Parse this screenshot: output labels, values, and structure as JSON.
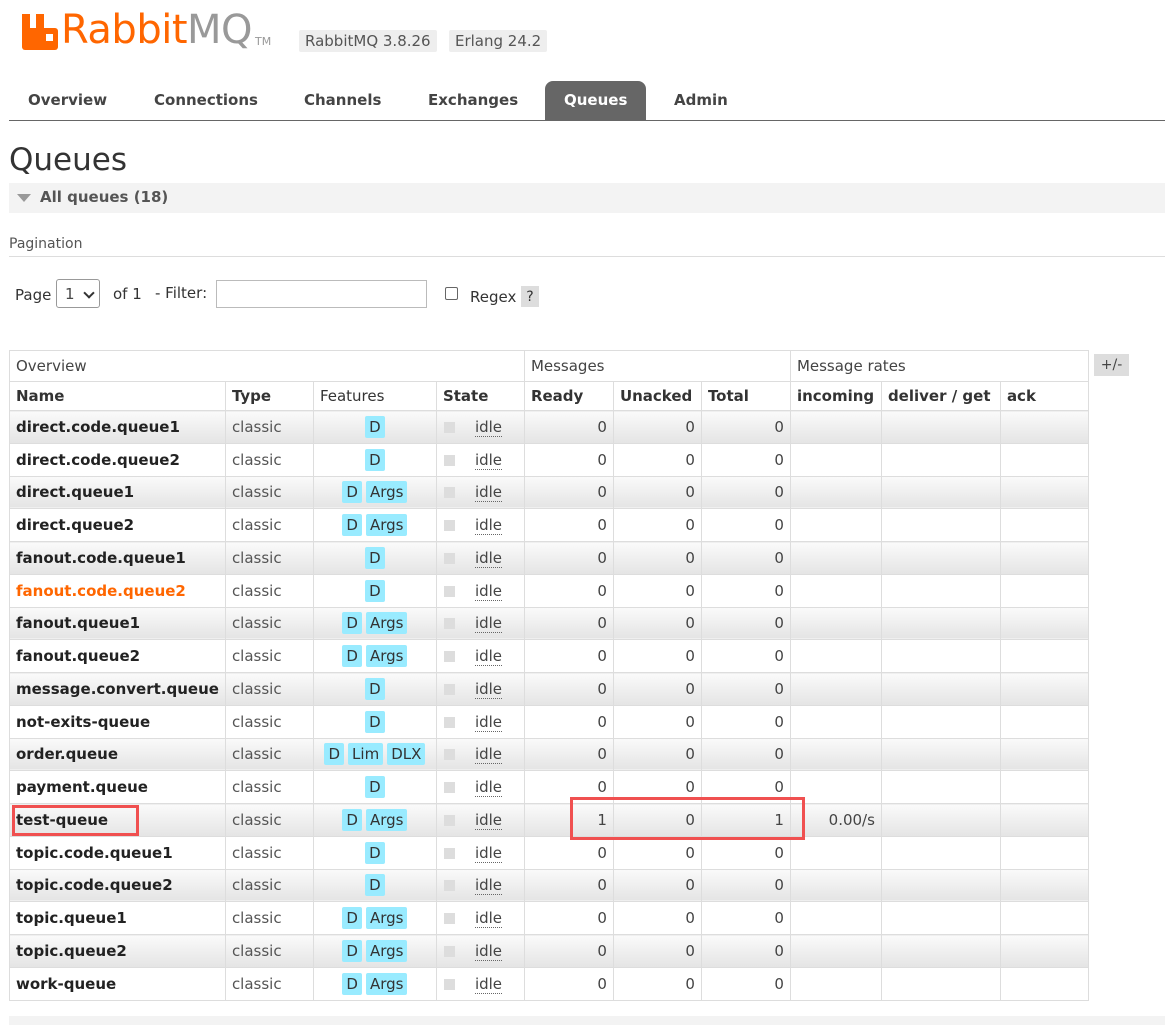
{
  "header": {
    "logo_rabbit": "Rabbit",
    "logo_mq": "MQ",
    "logo_tm": "TM",
    "rabbitmq_version": "RabbitMQ 3.8.26",
    "erlang_version": "Erlang 24.2",
    "brand_color": "#ff6600"
  },
  "tabs": [
    {
      "label": "Overview"
    },
    {
      "label": "Connections"
    },
    {
      "label": "Channels"
    },
    {
      "label": "Exchanges"
    },
    {
      "label": "Queues",
      "active": true
    },
    {
      "label": "Admin"
    }
  ],
  "page_title": "Queues",
  "section": {
    "title": "All queues (18)"
  },
  "pagination": {
    "label": "Pagination",
    "page_label": "Page",
    "page_value": "1",
    "of_label": "of 1",
    "filter_label": "- Filter:",
    "filter_value": "",
    "regex_label": "Regex",
    "regex_checked": false,
    "help_label": "?"
  },
  "columns_toggle": "+/-",
  "table": {
    "groups": [
      "Overview",
      "Messages",
      "Message rates"
    ],
    "columns": [
      "Name",
      "Type",
      "Features",
      "State",
      "Ready",
      "Unacked",
      "Total",
      "incoming",
      "deliver / get",
      "ack"
    ],
    "rows": [
      {
        "name": "direct.code.queue1",
        "type": "classic",
        "features": [
          "D"
        ],
        "state": "idle",
        "ready": "0",
        "unacked": "0",
        "total": "0",
        "incoming": "",
        "deliver": "",
        "ack": ""
      },
      {
        "name": "direct.code.queue2",
        "type": "classic",
        "features": [
          "D"
        ],
        "state": "idle",
        "ready": "0",
        "unacked": "0",
        "total": "0",
        "incoming": "",
        "deliver": "",
        "ack": ""
      },
      {
        "name": "direct.queue1",
        "type": "classic",
        "features": [
          "D",
          "Args"
        ],
        "state": "idle",
        "ready": "0",
        "unacked": "0",
        "total": "0",
        "incoming": "",
        "deliver": "",
        "ack": ""
      },
      {
        "name": "direct.queue2",
        "type": "classic",
        "features": [
          "D",
          "Args"
        ],
        "state": "idle",
        "ready": "0",
        "unacked": "0",
        "total": "0",
        "incoming": "",
        "deliver": "",
        "ack": ""
      },
      {
        "name": "fanout.code.queue1",
        "type": "classic",
        "features": [
          "D"
        ],
        "state": "idle",
        "ready": "0",
        "unacked": "0",
        "total": "0",
        "incoming": "",
        "deliver": "",
        "ack": ""
      },
      {
        "name": "fanout.code.queue2",
        "type": "classic",
        "features": [
          "D"
        ],
        "state": "idle",
        "ready": "0",
        "unacked": "0",
        "total": "0",
        "incoming": "",
        "deliver": "",
        "ack": "",
        "hover": true
      },
      {
        "name": "fanout.queue1",
        "type": "classic",
        "features": [
          "D",
          "Args"
        ],
        "state": "idle",
        "ready": "0",
        "unacked": "0",
        "total": "0",
        "incoming": "",
        "deliver": "",
        "ack": ""
      },
      {
        "name": "fanout.queue2",
        "type": "classic",
        "features": [
          "D",
          "Args"
        ],
        "state": "idle",
        "ready": "0",
        "unacked": "0",
        "total": "0",
        "incoming": "",
        "deliver": "",
        "ack": ""
      },
      {
        "name": "message.convert.queue",
        "type": "classic",
        "features": [
          "D"
        ],
        "state": "idle",
        "ready": "0",
        "unacked": "0",
        "total": "0",
        "incoming": "",
        "deliver": "",
        "ack": ""
      },
      {
        "name": "not-exits-queue",
        "type": "classic",
        "features": [
          "D"
        ],
        "state": "idle",
        "ready": "0",
        "unacked": "0",
        "total": "0",
        "incoming": "",
        "deliver": "",
        "ack": ""
      },
      {
        "name": "order.queue",
        "type": "classic",
        "features": [
          "D",
          "Lim",
          "DLX"
        ],
        "state": "idle",
        "ready": "0",
        "unacked": "0",
        "total": "0",
        "incoming": "",
        "deliver": "",
        "ack": ""
      },
      {
        "name": "payment.queue",
        "type": "classic",
        "features": [
          "D"
        ],
        "state": "idle",
        "ready": "0",
        "unacked": "0",
        "total": "0",
        "incoming": "",
        "deliver": "",
        "ack": ""
      },
      {
        "name": "test-queue",
        "type": "classic",
        "features": [
          "D",
          "Args"
        ],
        "state": "idle",
        "ready": "1",
        "unacked": "0",
        "total": "1",
        "incoming": "0.00/s",
        "deliver": "",
        "ack": ""
      },
      {
        "name": "topic.code.queue1",
        "type": "classic",
        "features": [
          "D"
        ],
        "state": "idle",
        "ready": "0",
        "unacked": "0",
        "total": "0",
        "incoming": "",
        "deliver": "",
        "ack": ""
      },
      {
        "name": "topic.code.queue2",
        "type": "classic",
        "features": [
          "D"
        ],
        "state": "idle",
        "ready": "0",
        "unacked": "0",
        "total": "0",
        "incoming": "",
        "deliver": "",
        "ack": ""
      },
      {
        "name": "topic.queue1",
        "type": "classic",
        "features": [
          "D",
          "Args"
        ],
        "state": "idle",
        "ready": "0",
        "unacked": "0",
        "total": "0",
        "incoming": "",
        "deliver": "",
        "ack": ""
      },
      {
        "name": "topic.queue2",
        "type": "classic",
        "features": [
          "D",
          "Args"
        ],
        "state": "idle",
        "ready": "0",
        "unacked": "0",
        "total": "0",
        "incoming": "",
        "deliver": "",
        "ack": ""
      },
      {
        "name": "work-queue",
        "type": "classic",
        "features": [
          "D",
          "Args"
        ],
        "state": "idle",
        "ready": "0",
        "unacked": "0",
        "total": "0",
        "incoming": "",
        "deliver": "",
        "ack": ""
      }
    ]
  },
  "annotation_color": "#f05050"
}
